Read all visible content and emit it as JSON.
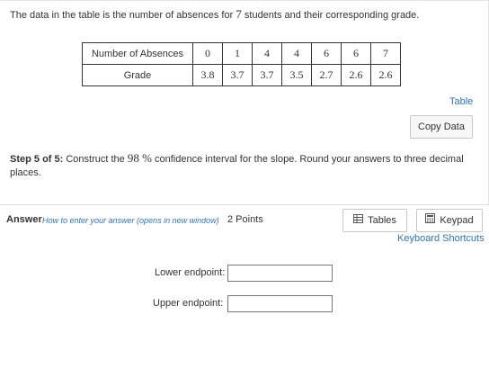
{
  "intro": {
    "before": "The data in the table is the number of absences for",
    "n": "7",
    "after": "students and their corresponding grade."
  },
  "table": {
    "row1_header": "Number of Absences",
    "row1_values": [
      "0",
      "1",
      "4",
      "4",
      "6",
      "6",
      "7"
    ],
    "row2_header": "Grade",
    "row2_values": [
      "3.8",
      "3.7",
      "3.7",
      "3.5",
      "2.7",
      "2.6",
      "2.6"
    ]
  },
  "links": {
    "table": "Table",
    "keyboard_shortcuts": "Keyboard Shortcuts"
  },
  "buttons": {
    "copy_data": "Copy Data",
    "tables": "Tables",
    "keypad": "Keypad"
  },
  "step": {
    "label": "Step 5 of 5:",
    "before": "Construct the",
    "percent": "98 %",
    "after": "confidence interval for the slope. Round your answers to three decimal places."
  },
  "answer": {
    "label": "Answer",
    "howto": "How to enter your answer (opens in new window)",
    "points": "2 Points"
  },
  "fields": {
    "lower_label": "Lower endpoint:",
    "lower_value": "",
    "upper_label": "Upper endpoint:",
    "upper_value": ""
  },
  "icons": {
    "tables": "table-grid-icon",
    "keypad": "keypad-icon"
  },
  "colors": {
    "link": "#2f74b5",
    "text": "#333333"
  }
}
